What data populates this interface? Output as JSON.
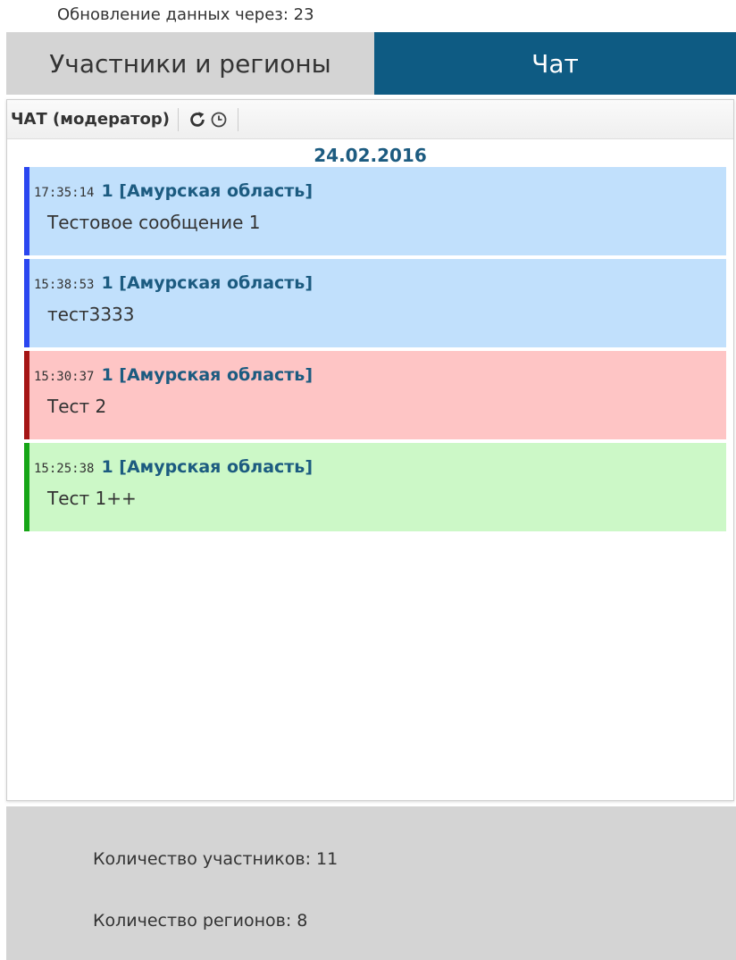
{
  "refresh_notice": "Обновление данных через: 23",
  "tabs": [
    {
      "label": "Участники и регионы",
      "active": false
    },
    {
      "label": "Чат",
      "active": true
    }
  ],
  "chat": {
    "title": "ЧАТ (модератор)",
    "toolbar_icons": [
      "refresh-icon",
      "clock-icon"
    ],
    "date": "24.02.2016",
    "messages": [
      {
        "time": "17:35:14",
        "author": "1 [Амурская область]",
        "text": "Тестовое сообщение 1",
        "bg": "#c1e0fc",
        "accent": "#2a46f0"
      },
      {
        "time": "15:38:53",
        "author": "1 [Амурская область]",
        "text": "тест3333",
        "bg": "#c1e0fc",
        "accent": "#2a46f0"
      },
      {
        "time": "15:30:37",
        "author": "1 [Амурская область]",
        "text": "Тест 2",
        "bg": "#fec5c5",
        "accent": "#a51515"
      },
      {
        "time": "15:25:38",
        "author": "1 [Амурская область]",
        "text": "Тест 1++",
        "bg": "#ccf8c7",
        "accent": "#16a516"
      }
    ]
  },
  "footer": {
    "participants": "Количество участников: 11",
    "regions": "Количество регионов: 8"
  },
  "colors": {
    "tab_active_bg": "#0e5b83",
    "tab_inactive_bg": "#d4d4d4",
    "author_color": "#1c5b80"
  }
}
